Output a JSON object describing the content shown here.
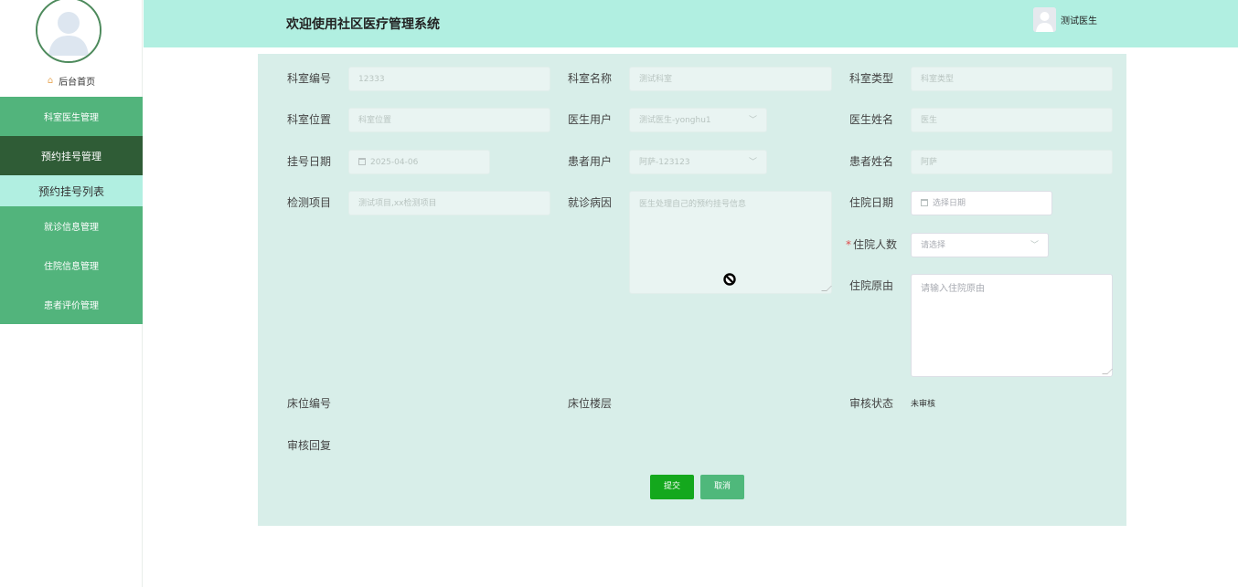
{
  "header": {
    "title": "欢迎使用社区医疗管理系统",
    "user_name": "测试医生"
  },
  "sidebar": {
    "home": "后台首页",
    "items": [
      {
        "label": "科室医生管理"
      },
      {
        "label": "预约挂号管理"
      },
      {
        "label": "预约挂号列表"
      },
      {
        "label": "就诊信息管理"
      },
      {
        "label": "住院信息管理"
      },
      {
        "label": "患者评价管理"
      }
    ]
  },
  "form": {
    "dept_no": {
      "label": "科室编号",
      "value": "12333"
    },
    "dept_name": {
      "label": "科室名称",
      "value": "测试科室"
    },
    "dept_type": {
      "label": "科室类型",
      "placeholder": "科室类型"
    },
    "dept_location": {
      "label": "科室位置",
      "placeholder": "科室位置"
    },
    "doctor_user": {
      "label": "医生用户",
      "value": "测试医生-yonghu1"
    },
    "doctor_name": {
      "label": "医生姓名",
      "value": "医生"
    },
    "reg_date": {
      "label": "挂号日期",
      "value": "2025-04-06"
    },
    "patient_user": {
      "label": "患者用户",
      "value": "阿萨-123123"
    },
    "patient_name": {
      "label": "患者姓名",
      "value": "阿萨"
    },
    "test_items": {
      "label": "检测项目",
      "value": "测试项目,xx检测项目"
    },
    "diagnosis": {
      "label": "就诊病因",
      "value": "医生处理自己的预约挂号信息"
    },
    "admit_date": {
      "label": "住院日期",
      "placeholder": "选择日期"
    },
    "admit_count": {
      "label": "住院人数",
      "placeholder": "请选择"
    },
    "admit_reason": {
      "label": "住院原由",
      "placeholder": "请输入住院原由"
    },
    "bed_no": {
      "label": "床位编号"
    },
    "bed_floor": {
      "label": "床位楼层"
    },
    "review_status": {
      "label": "审核状态",
      "value": "未审核"
    },
    "review_reply": {
      "label": "审核回复"
    }
  },
  "buttons": {
    "submit": "提交",
    "cancel": "取消"
  },
  "colors": {
    "header_bg": "#b1efe1",
    "menu_bg": "#52b47c",
    "menu_active": "#2f5c36",
    "panel_bg": "#d8eee9",
    "submit": "#14a81d"
  }
}
